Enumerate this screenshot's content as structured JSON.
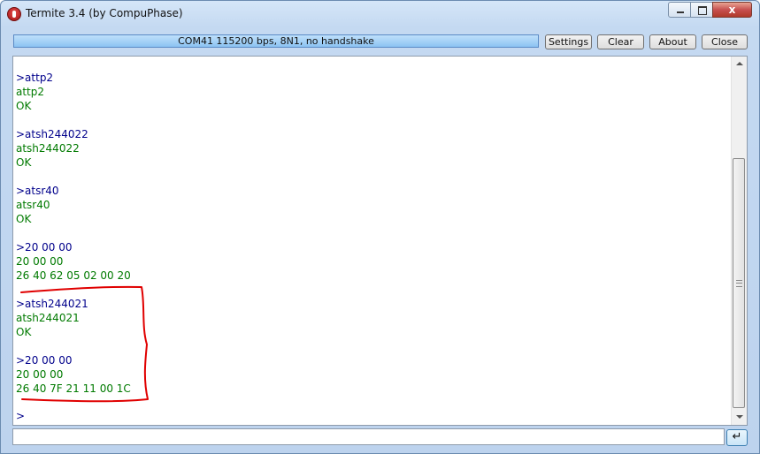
{
  "window": {
    "title": "Termite 3.4 (by CompuPhase)",
    "controls": {
      "minimize_icon": "minimize-icon",
      "maximize_icon": "maximize-icon",
      "close_glyph": "x"
    }
  },
  "toolbar": {
    "status": "COM41 115200 bps, 8N1, no handshake",
    "settings_label": "Settings",
    "clear_label": "Clear",
    "about_label": "About",
    "close_label": "Close"
  },
  "terminal": {
    "lines": [
      {
        "kind": "sent",
        "text": ">attp2"
      },
      {
        "kind": "recv",
        "text": "attp2"
      },
      {
        "kind": "recv",
        "text": "OK"
      },
      {
        "kind": "blank",
        "text": ""
      },
      {
        "kind": "sent",
        "text": ">atsh244022"
      },
      {
        "kind": "recv",
        "text": "atsh244022"
      },
      {
        "kind": "recv",
        "text": "OK"
      },
      {
        "kind": "blank",
        "text": ""
      },
      {
        "kind": "sent",
        "text": ">atsr40"
      },
      {
        "kind": "recv",
        "text": "atsr40"
      },
      {
        "kind": "recv",
        "text": "OK"
      },
      {
        "kind": "blank",
        "text": ""
      },
      {
        "kind": "sent",
        "text": ">20 00 00"
      },
      {
        "kind": "recv",
        "text": "20 00 00"
      },
      {
        "kind": "recv",
        "text": "26 40 62 05 02 00 20"
      },
      {
        "kind": "blank",
        "text": ""
      },
      {
        "kind": "sent",
        "text": ">atsh244021"
      },
      {
        "kind": "recv",
        "text": "atsh244021"
      },
      {
        "kind": "recv",
        "text": "OK"
      },
      {
        "kind": "blank",
        "text": ""
      },
      {
        "kind": "sent",
        "text": ">20 00 00"
      },
      {
        "kind": "recv",
        "text": "20 00 00"
      },
      {
        "kind": "recv",
        "text": "26 40 7F 21 11 00 1C"
      }
    ],
    "prompt": ">",
    "annotation_color": "#e00000"
  },
  "input": {
    "value": "",
    "send_glyph": "↵"
  },
  "colors": {
    "sent_text": "#00008b",
    "received_text": "#007a00"
  }
}
